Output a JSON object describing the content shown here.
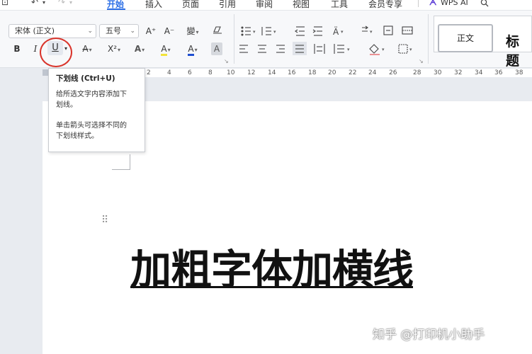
{
  "menubar": {
    "quick_access": [
      "⊡",
      "↶",
      "▾",
      "↷",
      "▾"
    ],
    "tabs": [
      {
        "label": "开始",
        "active": true
      },
      {
        "label": "插入"
      },
      {
        "label": "页面"
      },
      {
        "label": "引用"
      },
      {
        "label": "审阅"
      },
      {
        "label": "视图"
      },
      {
        "label": "工具"
      },
      {
        "label": "会员专享"
      }
    ],
    "ai_label": "WPS AI"
  },
  "ribbon": {
    "font_name": "宋体 (正文)",
    "font_size": "五号",
    "row1": {
      "grow_font": "A⁺",
      "shrink_font": "A⁻",
      "phonetic": "變",
      "clear_format": "◇"
    },
    "row2": {
      "bold": "B",
      "italic": "I",
      "underline": "U",
      "strikethrough": "A",
      "superscript": "X²",
      "text_effect": "A",
      "highlight": "A",
      "font_color": "A",
      "char_shading": "A"
    },
    "styles": {
      "normal": "正文",
      "heading": "标题"
    },
    "accent_color": "#2b6ee6",
    "font_color_bar": "#1f4fd1",
    "highlight_bar": "#f2e33a"
  },
  "ruler": {
    "ticks": [
      "2",
      "4",
      "6",
      "8",
      "10",
      "12",
      "14",
      "16",
      "18",
      "20",
      "22",
      "24",
      "26",
      "28",
      "30",
      "32",
      "34",
      "36",
      "38"
    ]
  },
  "tooltip": {
    "title": "下划线 (Ctrl+U)",
    "line1": "给所选文字内容添加下",
    "line2": "划线。",
    "line3": "单击箭头可选择不同的",
    "line4": "下划线样式。"
  },
  "document": {
    "text": "加粗字体加横线"
  },
  "watermark": "知乎 @打印机小助手",
  "highlight_color": "#d9342b"
}
